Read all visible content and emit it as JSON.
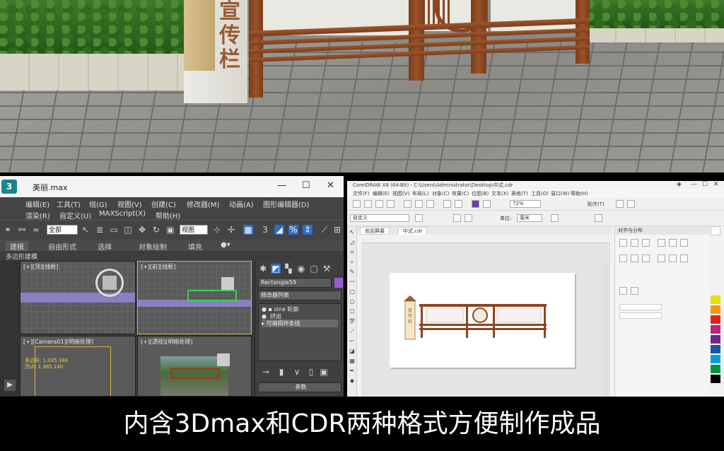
{
  "scene": {
    "sign_text": "宣\n传\n栏"
  },
  "max": {
    "title": "美丽.max",
    "menu_row1": [
      "编辑(E)",
      "工具(T)",
      "组(G)",
      "视图(V)",
      "创建(C)",
      "修改器(M)",
      "动画(A)",
      "图形编辑器(D)"
    ],
    "menu_row2": [
      "渲染(R)",
      "自定义(U)",
      "MAXScript(X)",
      "帮助(H)"
    ],
    "selection_set": "全部",
    "view_set": "视图",
    "ribbon": [
      "建模",
      "自由形式",
      "选择",
      "对象绘制",
      "填充"
    ],
    "subribbon": "多边形建模",
    "viewports": [
      {
        "label": "[+][顶][线框]"
      },
      {
        "label": "[+][前][线框]"
      },
      {
        "label": "[+][Camera01][明暗处理]"
      },
      {
        "label": "[+][透视][明暗处理]"
      }
    ],
    "camera_readout": [
      "多边形: 1,035,184",
      "顶点: 1,365,140"
    ],
    "object_name": "Rectangle59",
    "modifier_list_label": "修改器列表",
    "modifier_stack": [
      "sine 轮廓",
      "挤出",
      "可编辑样条线"
    ],
    "params_label": "参数"
  },
  "cdr": {
    "title": "CorelDRAW X8 (64-Bit) - C:\\Users\\Administrator\\Desktop\\中式.cdr",
    "menu": [
      "文件(F)",
      "编辑(E)",
      "视图(V)",
      "布局(L)",
      "对象(C)",
      "效果(C)",
      "位图(B)",
      "文本(X)",
      "表格(T)",
      "工具(O)",
      "窗口(W)",
      "帮助(H)"
    ],
    "zoom": "72%",
    "snap_label": "贴齐(T)",
    "paper": "自定义",
    "units_label": "单位:",
    "units": "毫米",
    "tabs": [
      "欢迎屏幕",
      "中式.cdr"
    ],
    "docker_title": "对齐与分布",
    "sign_text": "宣传栏"
  },
  "caption": "内含3Dmax和CDR两种格式方便制作成品",
  "colors": {
    "wood": "#8a4622",
    "panel": "#e9e8e3",
    "max_bg": "#3a3a3a",
    "cdr_bg": "#f2f2f2"
  }
}
